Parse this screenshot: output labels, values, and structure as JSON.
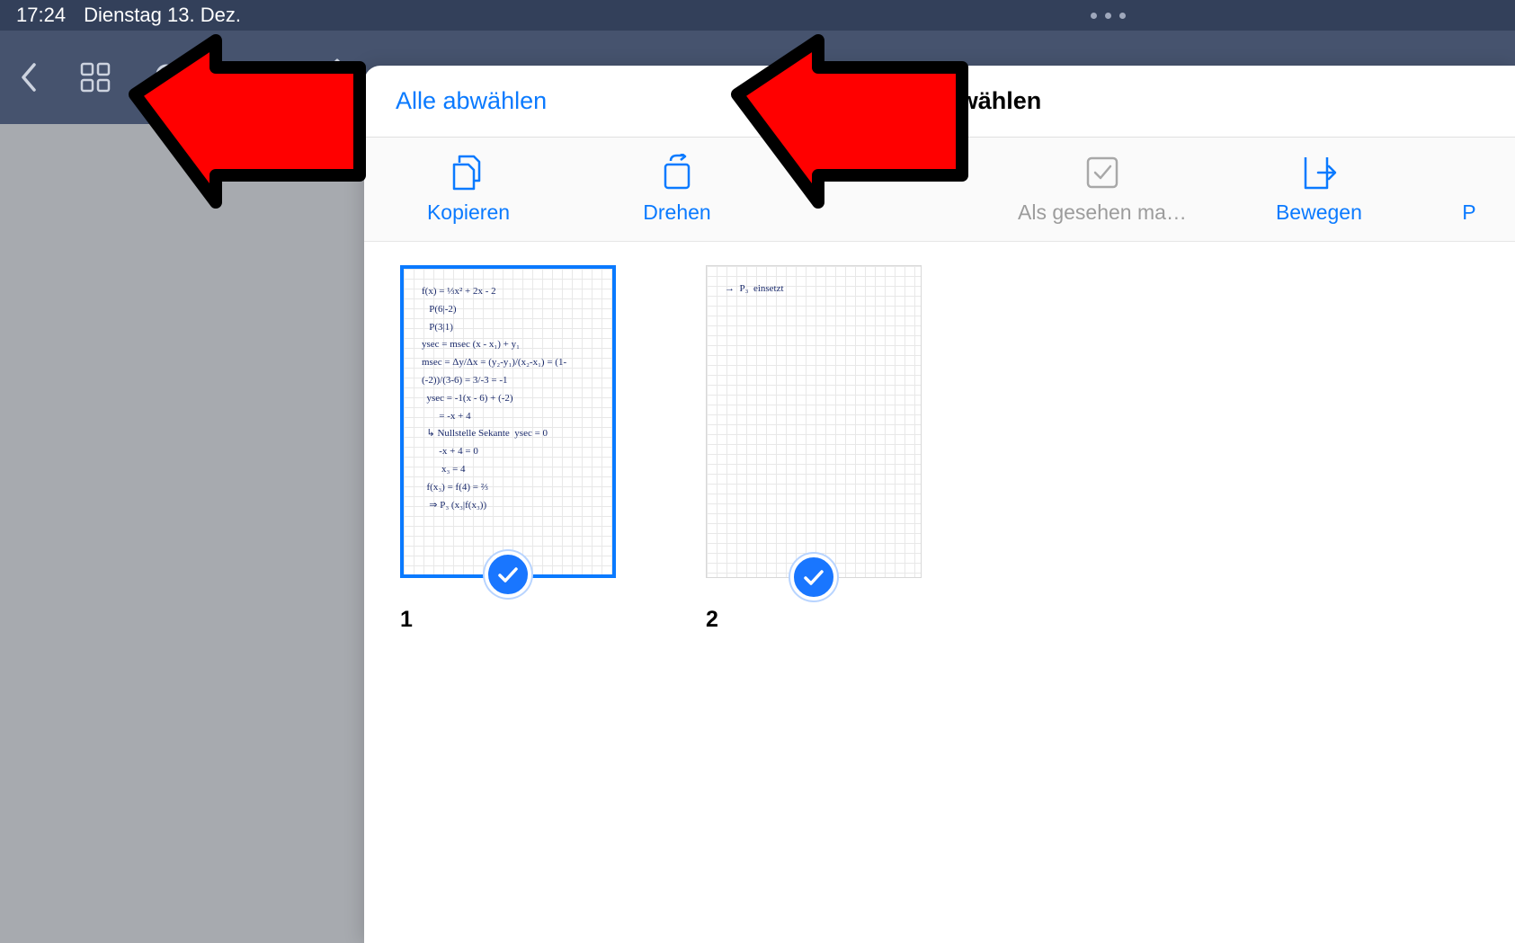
{
  "status": {
    "time": "17:24",
    "date": "Dienstag 13. Dez."
  },
  "modal": {
    "deselect_label": "Alle abwählen",
    "title": "Seiten auswählen"
  },
  "toolbar": {
    "copy": "Kopieren",
    "rotate": "Drehen",
    "seen": "Als gesehen ma…",
    "move": "Bewegen",
    "last_initial": "P"
  },
  "pages": [
    {
      "num": "1",
      "selected": true,
      "has_arrow": false
    },
    {
      "num": "2",
      "selected": true,
      "has_arrow": true
    }
  ],
  "thumb1_text": "f(x) = ⅓x² + 2x - 2\n   P(6|-2)\n   P(3|1)\nysec = msec (x - x₁) + y₁\nmsec = Δy/Δx = (y₂-y₁)/(x₂-x₁) = (1-(-2))/(3-6) = 3/-3 = -1\n  ysec = -1(x - 6) + (-2)\n       = -x + 4\n  ↳ Nullstelle Sekante  ysec = 0\n       -x + 4 = 0\n        x₃ = 4\n  f(x₃) = f(4) = ⅔\n   ⇒ P₃ (x₃|f(x₃))",
  "thumb2_text": "→  P₃  einsetzt"
}
